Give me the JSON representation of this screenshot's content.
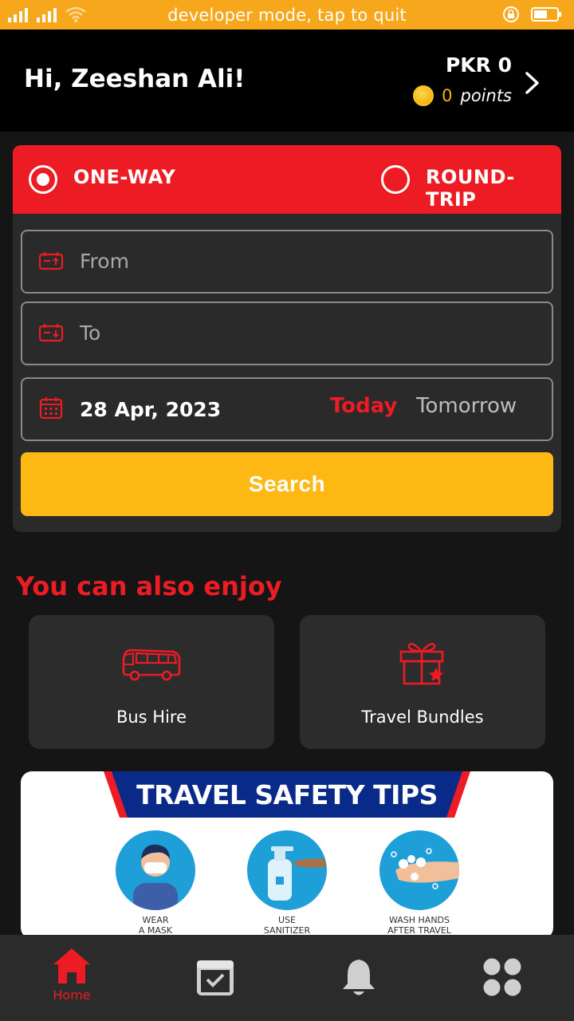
{
  "status_bar": {
    "developer_text": "developer mode, tap to quit"
  },
  "header": {
    "greeting": "Hi, Zeeshan Ali!",
    "balance": "PKR 0",
    "points_value": "0",
    "points_label": "points"
  },
  "search": {
    "one_way_label": "ONE-WAY",
    "round_trip_label": "ROUND-TRIP",
    "selected_trip": "ONE-WAY",
    "from_placeholder": "From",
    "to_placeholder": "To",
    "date_value": "28 Apr, 2023",
    "today_label": "Today",
    "tomorrow_label": "Tomorrow",
    "search_button": "Search"
  },
  "enjoy": {
    "title": "You can also enjoy",
    "tiles": [
      {
        "label": "Bus Hire",
        "icon": "bus-icon"
      },
      {
        "label": "Travel Bundles",
        "icon": "gift-icon"
      }
    ]
  },
  "safety_banner": {
    "title": "TRAVEL SAFETY TIPS",
    "tips": [
      {
        "line1": "WEAR",
        "line2": "A MASK"
      },
      {
        "line1": "USE",
        "line2": "SANITIZER"
      },
      {
        "line1": "WASH HANDS",
        "line2": "AFTER TRAVEL"
      }
    ]
  },
  "bottom_nav": {
    "items": [
      {
        "label": "Home",
        "icon": "home-icon",
        "active": true
      },
      {
        "label": "",
        "icon": "bookings-icon",
        "active": false
      },
      {
        "label": "",
        "icon": "bell-icon",
        "active": false
      },
      {
        "label": "",
        "icon": "menu-grid-icon",
        "active": false
      }
    ]
  },
  "colors": {
    "status_bar": "#f6a71c",
    "accent_red": "#ed1c24",
    "search_button": "#fdb813",
    "card_bg": "#2a2a2a",
    "background": "#151515"
  }
}
